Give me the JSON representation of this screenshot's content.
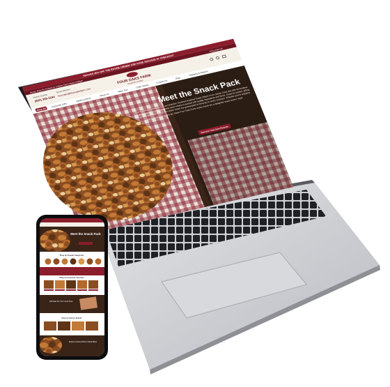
{
  "laptop": {
    "announcement": "SNACKS 25% OFF THE ENTIRE ORDER! USE CODE SNACK25 AT CHECKOUT",
    "hours": "Hours: Mon-Fri 8:30am to 4:30pm Sat 9:30am-3:00pm",
    "follow": "FOLLOW US",
    "phone_label": "Phone Number",
    "phone": "(800) 255-3194",
    "email_label": "Email Address",
    "email": "fourcaks@fouroaksfarm.com",
    "logo_line1": "FOUR OAKS FARM",
    "logo_line2": "COUNTRY STORE",
    "nav": [
      "Shop All",
      "Corporate Gifts",
      "Retail Location",
      "About Us",
      "Video Tour",
      "Order Status",
      "Contact Us",
      "Blog",
      "Shipping & Returns"
    ],
    "hero_title": "Meet the Snack Pack",
    "hero_text": "Our snacking experience with our premium Southern-inspired Snack Mixes! From classic Chex Mix with its timeless blend of sweet and salty goodness, each variety is packed with quality ingredients and flavor. Great for parties, gifting or an everyday pick-me-up, our snack mixes are guaranteed to bring joy to every occasion. Whether you're enjoying them at home or on the go, these Four Oaks Farm snack mixes are a delightful snack lovers' treat!",
    "cta": "Discover Your New Favorite"
  },
  "phone": {
    "hero_title": "Meet the Snack Pack",
    "section1": "Shop by Popular Categories",
    "section2": "Shop by Customer Favorites",
    "section3": "Gift Ideas For Your Loved Ones",
    "section4": "Shop by Savory Snacks",
    "section5": "Explore Country Kitchen Snack Mixes"
  }
}
